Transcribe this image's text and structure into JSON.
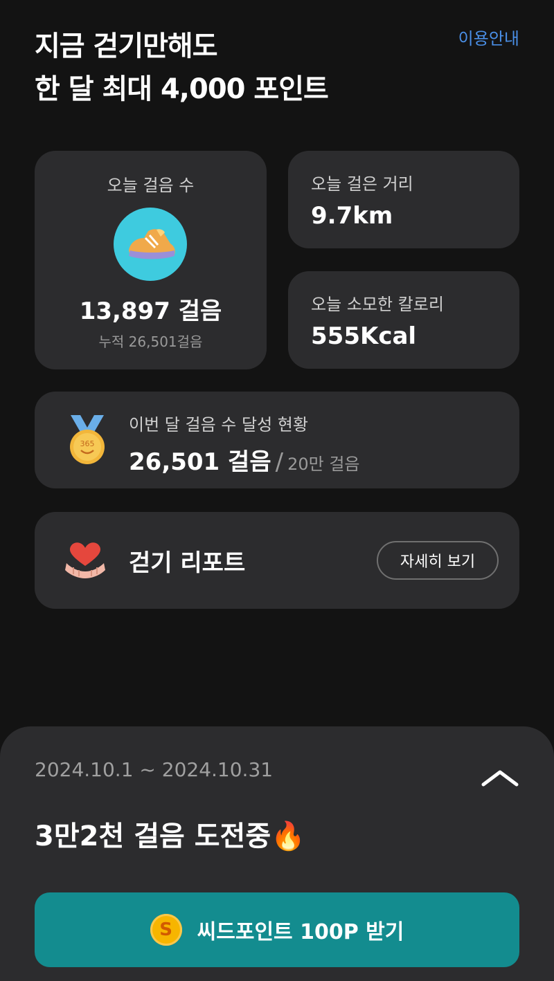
{
  "header": {
    "title_line1": "지금 걷기만해도",
    "title_line2": "한 달 최대 4,000 포인트",
    "guide_link": "이용안내"
  },
  "today_steps": {
    "label": "오늘 걸음 수",
    "icon": "sneaker-icon",
    "value": "13,897 걸음",
    "total": "누적 26,501걸음"
  },
  "distance": {
    "label": "오늘 걸은 거리",
    "value": "9.7km"
  },
  "calories": {
    "label": "오늘 소모한 칼로리",
    "value": "555Kcal"
  },
  "monthly": {
    "label": "이번 달 걸음 수 달성 현황",
    "current": "26,501 걸음",
    "separator": "/",
    "goal": "20만 걸음",
    "icon": "medal-icon",
    "medal_text": "365"
  },
  "report": {
    "title": "걷기 리포트",
    "detail_button": "자세히 보기",
    "icon": "heart-hands-icon"
  },
  "challenge": {
    "period": "2024.10.1 ~ 2024.10.31",
    "title": "3만2천 걸음 도전중🔥",
    "claim_coin": "S",
    "claim_label": "씨드포인트 100P 받기"
  },
  "colors": {
    "background": "#131313",
    "card": "#2c2c2e",
    "accent_link": "#4a8fe7",
    "claim_button": "#138c8f",
    "coin": "#f7b500"
  }
}
